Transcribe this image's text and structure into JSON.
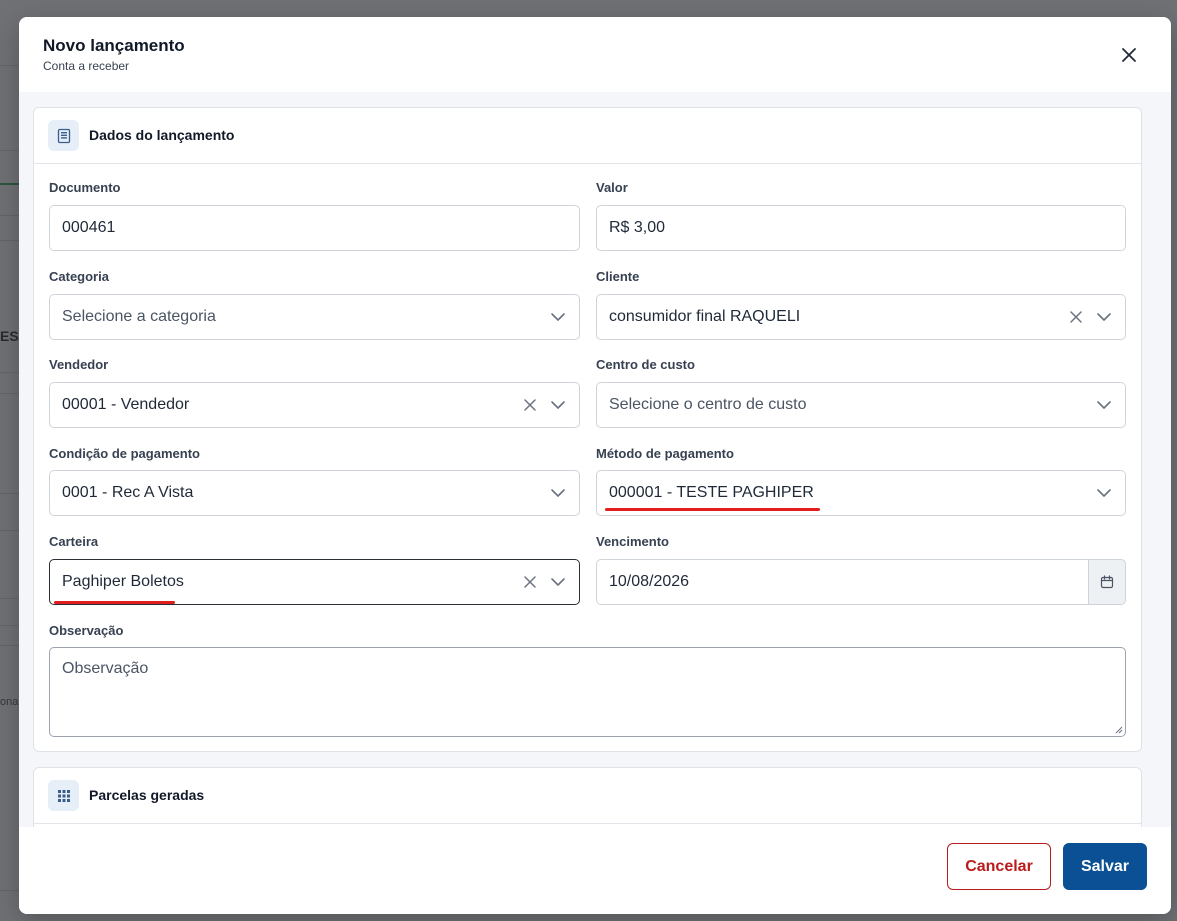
{
  "modal": {
    "title": "Novo lançamento",
    "subtitle": "Conta a receber"
  },
  "section_launch": {
    "title": "Dados do lançamento",
    "icon": "document-icon"
  },
  "fields": {
    "documento": {
      "label": "Documento",
      "value": "000461"
    },
    "valor": {
      "label": "Valor",
      "value": "R$ 3,00"
    },
    "categoria": {
      "label": "Categoria",
      "placeholder": "Selecione a categoria"
    },
    "cliente": {
      "label": "Cliente",
      "value": "consumidor final RAQUELI"
    },
    "vendedor": {
      "label": "Vendedor",
      "value": "00001 - Vendedor"
    },
    "centro_custo": {
      "label": "Centro de custo",
      "placeholder": "Selecione o centro de custo"
    },
    "condicao_pagamento": {
      "label": "Condição de pagamento",
      "value": "0001 - Rec A Vista"
    },
    "metodo_pagamento": {
      "label": "Método de pagamento",
      "value": "000001 - TESTE PAGHIPER"
    },
    "carteira": {
      "label": "Carteira",
      "value": "Paghiper Boletos"
    },
    "vencimento": {
      "label": "Vencimento",
      "value": "10/08/2026"
    },
    "observacao": {
      "label": "Observação",
      "placeholder": "Observação"
    }
  },
  "section_parcelas": {
    "title": "Parcelas geradas",
    "icon": "grid-icon"
  },
  "footer": {
    "cancel_label": "Cancelar",
    "save_label": "Salvar"
  },
  "background": {
    "left_text_1": "ES",
    "left_text_2": "ona"
  },
  "colors": {
    "primary": "#0b4f94",
    "danger": "#b91c1c",
    "highlight": "#e11d1d",
    "icon_bg": "#e6eef7"
  }
}
